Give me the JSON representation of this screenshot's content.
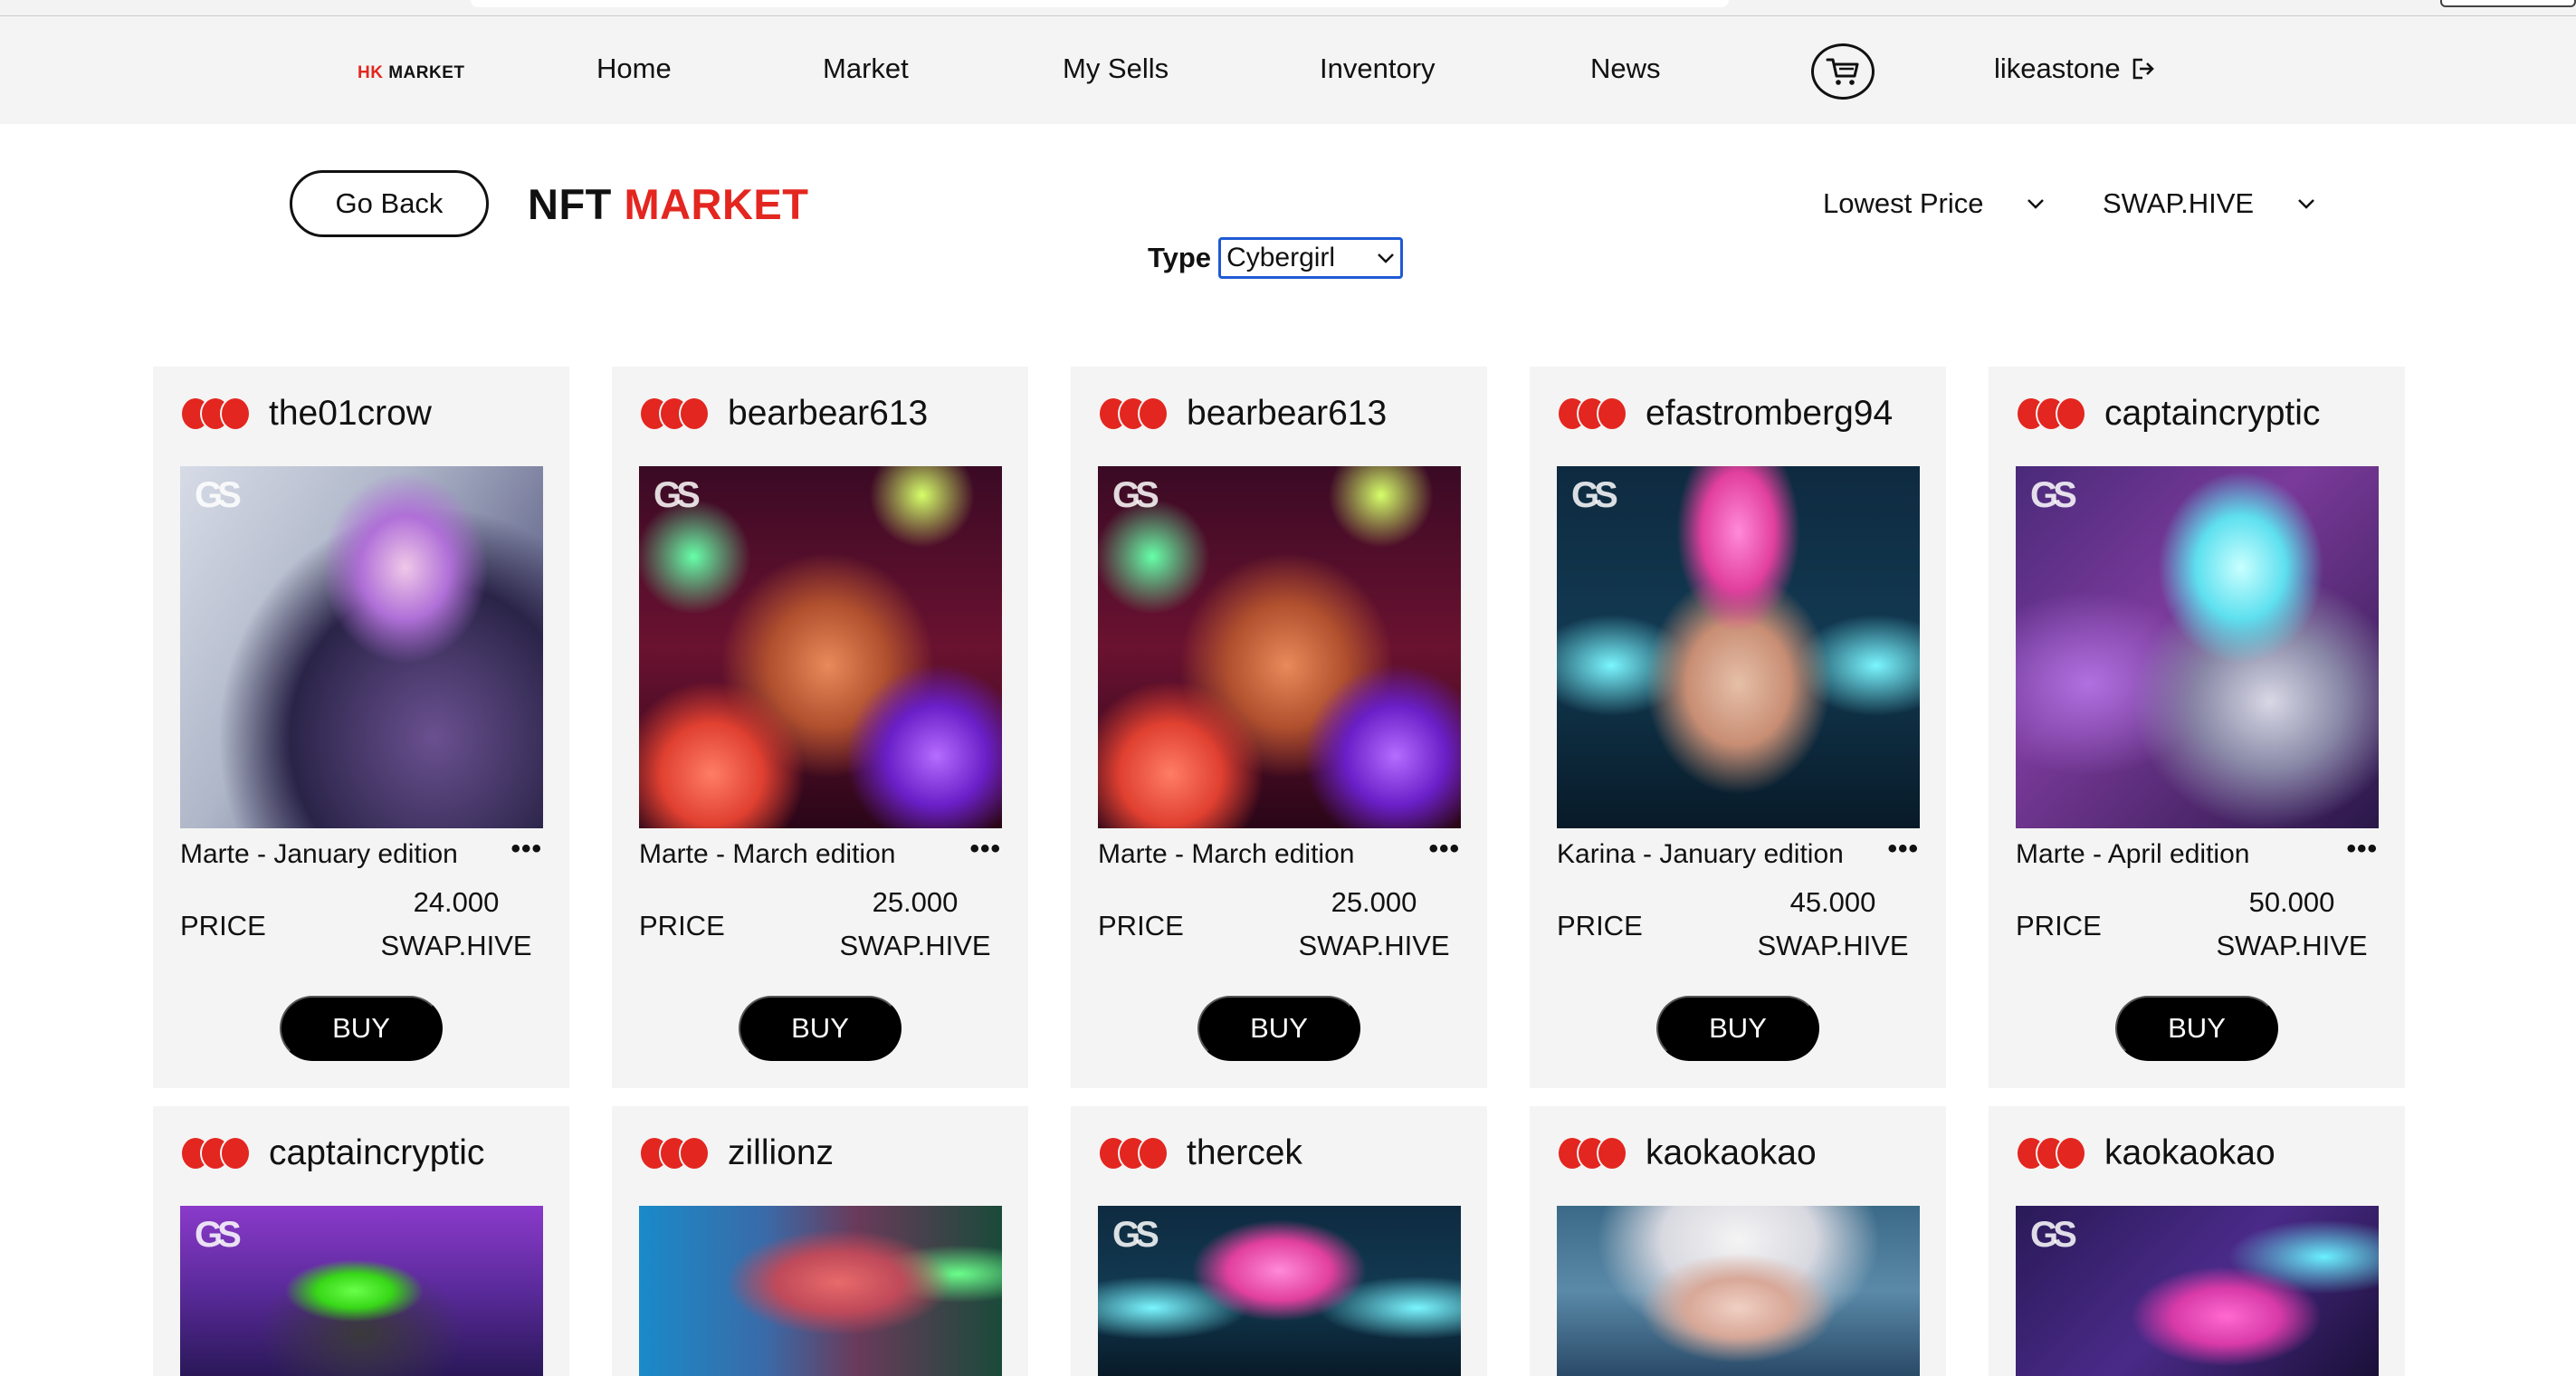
{
  "nav": {
    "logo_hk": "HK",
    "logo_market": "MARKET",
    "items": [
      "Home",
      "Market",
      "My Sells",
      "Inventory",
      "News"
    ],
    "username": "likeastone"
  },
  "controls": {
    "go_back": "Go Back",
    "title_part1": "NFT",
    "title_part2": "MARKET",
    "sort": "Lowest Price",
    "currency": "SWAP.HIVE",
    "type_label": "Type",
    "type_value": "Cybergirl"
  },
  "labels": {
    "price": "PRICE",
    "buy": "BUY",
    "more": "•••",
    "gs": "GS"
  },
  "colors": {
    "accent": "#e3261f",
    "select_border": "#1f5ad4"
  },
  "cards": [
    {
      "seller": "the01crow",
      "edition": "Marte - January edition",
      "price": "24.000",
      "currency": "SWAP.HIVE"
    },
    {
      "seller": "bearbear613",
      "edition": "Marte - March edition",
      "price": "25.000",
      "currency": "SWAP.HIVE"
    },
    {
      "seller": "bearbear613",
      "edition": "Marte - March edition",
      "price": "25.000",
      "currency": "SWAP.HIVE"
    },
    {
      "seller": "efastromberg94",
      "edition": "Karina - January edition",
      "price": "45.000",
      "currency": "SWAP.HIVE"
    },
    {
      "seller": "captaincryptic",
      "edition": "Marte - April edition",
      "price": "50.000",
      "currency": "SWAP.HIVE"
    },
    {
      "seller": "captaincryptic"
    },
    {
      "seller": "zillionz"
    },
    {
      "seller": "thercek"
    },
    {
      "seller": "kaokaokao"
    },
    {
      "seller": "kaokaokao"
    }
  ]
}
